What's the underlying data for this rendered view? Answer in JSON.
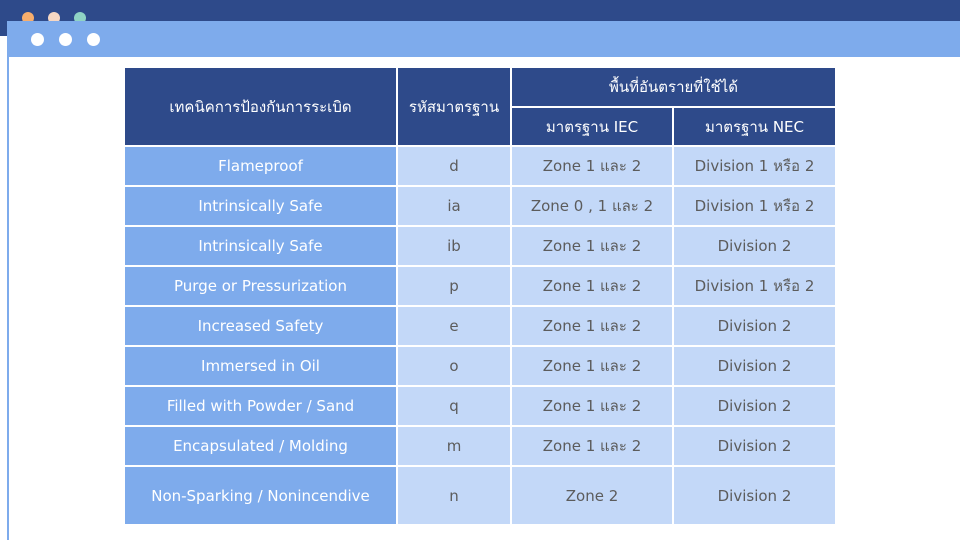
{
  "chrome": {
    "top_dots": [
      {
        "name": "orange-dot",
        "color": "#f8ae6c"
      },
      {
        "name": "peach-dot",
        "color": "#f5d7c4"
      },
      {
        "name": "teal-dot",
        "color": "#8fd3c4"
      }
    ],
    "window_dots_color": "#ffffff",
    "colors": {
      "header_bg": "#2e4a8a",
      "first_col_bg": "#7eabec",
      "cell_bg": "#c3d8f8",
      "cell_text": "#5c5c5c"
    }
  },
  "table": {
    "headers": {
      "technique": "เทคนิคการป้องกันการระเบิด",
      "code": "รหัสมาตรฐาน",
      "hazard_area": "พื้นที่อันตรายที่ใช้ได้",
      "iec": "มาตรฐาน IEC",
      "nec": "มาตรฐาน NEC"
    },
    "rows": [
      {
        "technique": "Flameproof",
        "code": "d",
        "iec": "Zone 1 และ 2",
        "nec": "Division 1 หรือ 2"
      },
      {
        "technique": "Intrinsically Safe",
        "code": "ia",
        "iec": "Zone 0 , 1 และ 2",
        "nec": "Division 1 หรือ 2"
      },
      {
        "technique": "Intrinsically Safe",
        "code": "ib",
        "iec": "Zone 1 และ 2",
        "nec": "Division 2"
      },
      {
        "technique": "Purge or Pressurization",
        "code": "p",
        "iec": "Zone 1 และ 2",
        "nec": "Division 1 หรือ 2"
      },
      {
        "technique": "Increased Safety",
        "code": "e",
        "iec": "Zone 1 และ 2",
        "nec": "Division 2"
      },
      {
        "technique": "Immersed in Oil",
        "code": "o",
        "iec": "Zone 1 และ 2",
        "nec": "Division 2"
      },
      {
        "technique": "Filled with Powder / Sand",
        "code": "q",
        "iec": "Zone 1 และ 2",
        "nec": "Division 2"
      },
      {
        "technique": "Encapsulated / Molding",
        "code": "m",
        "iec": "Zone 1 และ 2",
        "nec": "Division 2"
      },
      {
        "technique": "Non-Sparking / Nonincendive",
        "code": "n",
        "iec": "Zone 2",
        "nec": "Division 2"
      }
    ]
  }
}
